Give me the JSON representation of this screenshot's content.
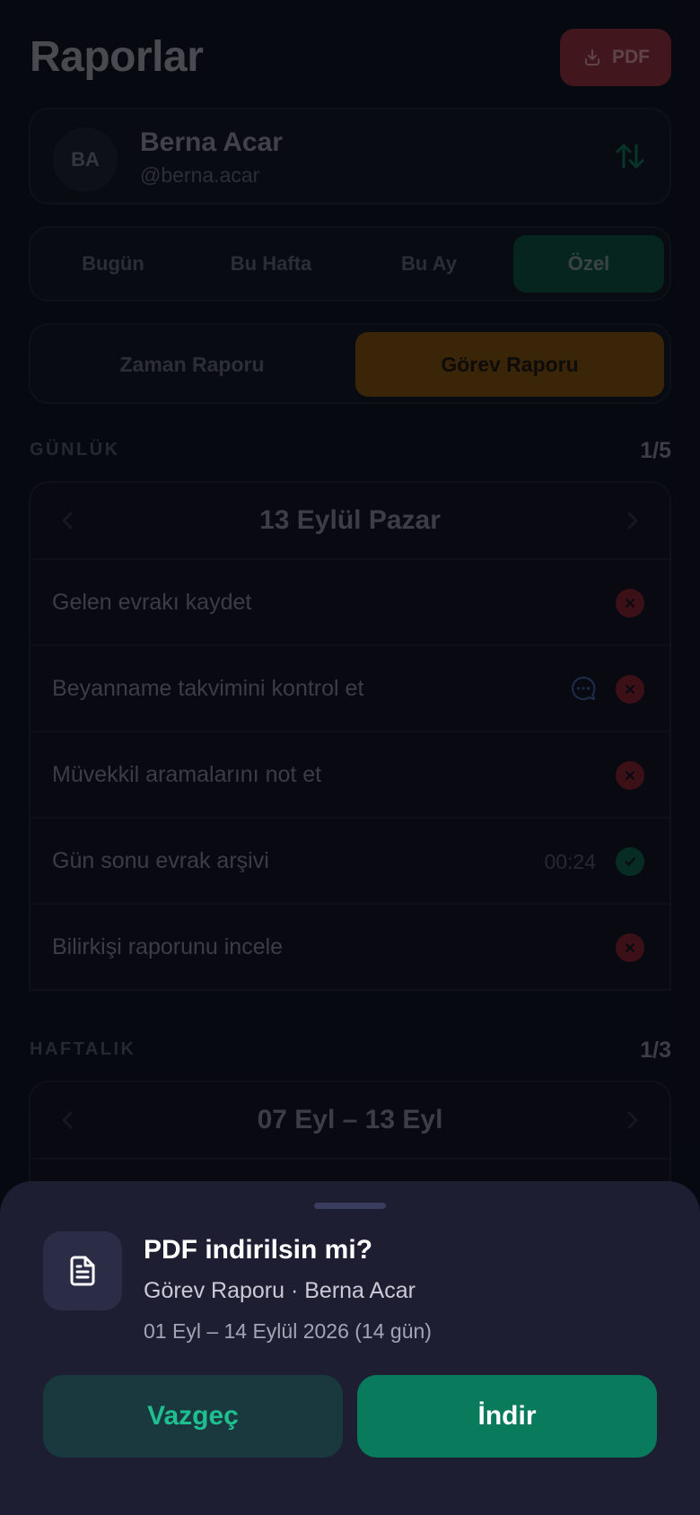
{
  "header": {
    "title": "Raporlar",
    "pdf_label": "PDF"
  },
  "user": {
    "initials": "BA",
    "name": "Berna Acar",
    "handle": "@berna.acar"
  },
  "period_tabs": [
    {
      "label": "Bugün",
      "active": false
    },
    {
      "label": "Bu Hafta",
      "active": false
    },
    {
      "label": "Bu Ay",
      "active": false
    },
    {
      "label": "Özel",
      "active": true
    }
  ],
  "report_tabs": [
    {
      "label": "Zaman Raporu",
      "active": false
    },
    {
      "label": "Görev Raporu",
      "active": true
    }
  ],
  "daily": {
    "label": "GÜNLÜK",
    "count": "1/5",
    "date": "13 Eylül Pazar",
    "tasks": [
      {
        "title": "Gelen evrakı kaydet",
        "status": "fail"
      },
      {
        "title": "Beyanname takvimini kontrol et",
        "status": "fail",
        "comment_icon": "chat-bubble-icon"
      },
      {
        "title": "Müvekkil aramalarını not et",
        "status": "fail"
      },
      {
        "title": "Gün sonu evrak arşivi",
        "status": "ok",
        "duration": "00:24"
      },
      {
        "title": "Bilirkişi raporunu incele",
        "status": "fail"
      }
    ]
  },
  "weekly": {
    "label": "HAFTALIK",
    "count": "1/3",
    "date": "07 Eyl – 13 Eyl"
  },
  "sheet": {
    "title": "PDF indirilsin mi?",
    "subtitle": "Görev Raporu · Berna Acar",
    "range": "01 Eyl – 14 Eylül 2026 (14 gün)",
    "cancel_label": "Vazgeç",
    "download_label": "İndir"
  },
  "colors": {
    "accent_green": "#0a7a5c",
    "accent_orange": "#7a4a05",
    "danger": "#8a2a31"
  }
}
